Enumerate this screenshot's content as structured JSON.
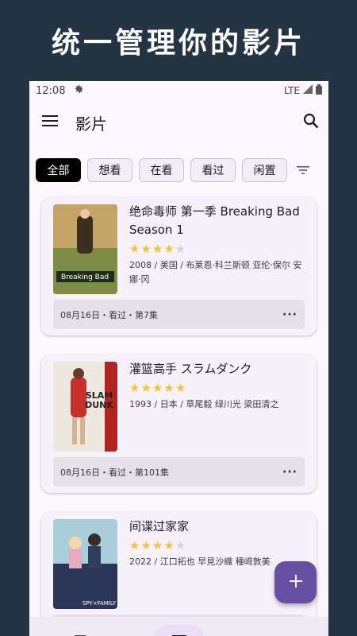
{
  "banner": {
    "title": "统一管理你的影片"
  },
  "status": {
    "time": "12:08",
    "network": "LTE"
  },
  "appbar": {
    "title": "影片"
  },
  "filters": [
    {
      "label": "全部",
      "active": true
    },
    {
      "label": "想看",
      "active": false
    },
    {
      "label": "在看",
      "active": false
    },
    {
      "label": "看过",
      "active": false
    },
    {
      "label": "闲置",
      "active": false
    }
  ],
  "movies": [
    {
      "title": "绝命毒师 第一季 Breaking Bad Season 1",
      "rating": 4,
      "meta": "2008 / 美国 / 布莱恩·科兰斯顿 亚伦·保尔 安娜·冈",
      "footer": "08月16日・看过・第7集",
      "poster_colors": [
        "#b79a5a",
        "#6e8f3c",
        "#2c3b24"
      ],
      "poster_text": "Breaking Bad"
    },
    {
      "title": "灌篮高手 スラムダンク",
      "rating": 5,
      "meta": "1993 / 日本 / 草尾毅 绿川光 梁田清之",
      "footer": "08月16日・看过・第101集",
      "poster_colors": [
        "#e7e2db",
        "#b3231f",
        "#302a2a"
      ],
      "poster_text": "SLAM DUNK"
    },
    {
      "title": "间谍过家家",
      "rating": 4,
      "meta": "2022 / 江口拓也 早見沙織 種﨑敦美",
      "footer": "",
      "poster_colors": [
        "#9ec7d6",
        "#5a6f86",
        "#1d2540"
      ],
      "poster_text": "SPY×FAMILY"
    }
  ],
  "colors": {
    "accent": "#6750a4",
    "star": "#f5c431",
    "banner_bg": "#233443"
  }
}
